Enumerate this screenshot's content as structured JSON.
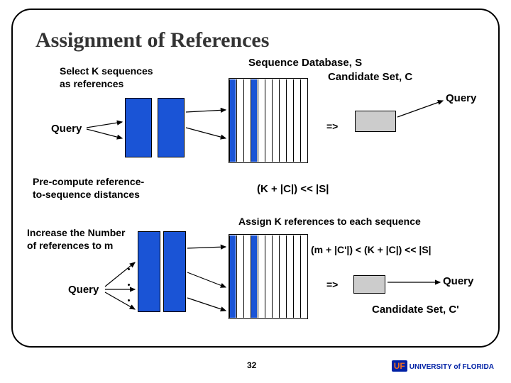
{
  "title": "Assignment of References",
  "labels": {
    "select_k": "Select K sequences\nas references",
    "db": "Sequence Database, S",
    "cand1": "Candidate Set, C",
    "query": "Query",
    "arrow": "=>",
    "precompute": "Pre-compute reference-\nto-sequence distances",
    "formula1": "(K  +  |C|) << |S|",
    "assign": "Assign K references to each sequence",
    "increase": "Increase the Number\nof references to m",
    "formula2": "(m + |C'|) < (K  +  |C|) << |S|",
    "cand2": "Candidate Set, C'"
  },
  "page_number": "32",
  "logo": {
    "mark": "UF",
    "text": "UNIVERSITY of FLORIDA"
  }
}
